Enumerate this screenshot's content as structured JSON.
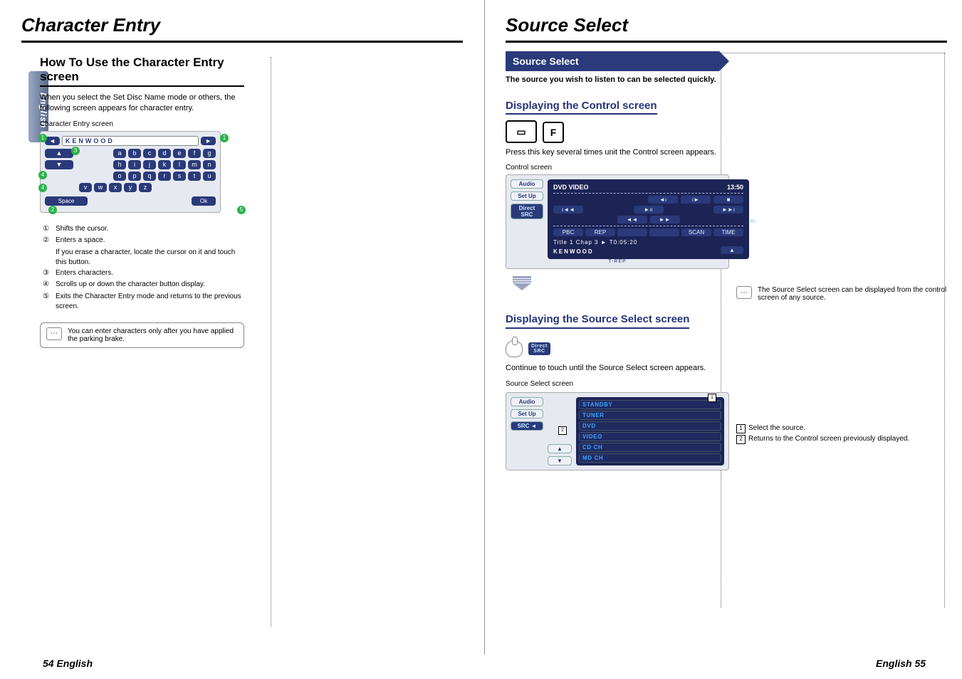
{
  "lang_tab": "English",
  "left": {
    "title": "Character Entry",
    "section_head": "How To Use the Character Entry screen",
    "intro": "When you select the Set Disc Name mode or others, the following screen appears for character entry.",
    "screen_caption": "Character Entry screen",
    "ce": {
      "text_value": "KENWOOD",
      "rows": [
        [
          "a",
          "b",
          "c",
          "d",
          "e",
          "f",
          "g"
        ],
        [
          "h",
          "i",
          "j",
          "k",
          "l",
          "m",
          "n"
        ],
        [
          "o",
          "p",
          "q",
          "r",
          "s",
          "t",
          "u"
        ],
        [
          "v",
          "w",
          "x",
          "y",
          "z"
        ]
      ],
      "space_label": "Space",
      "ok_label": "Ok",
      "badges": {
        "1": "1",
        "2": "2",
        "3": "3",
        "4": "4",
        "5": "5"
      }
    },
    "list": {
      "1": "Shifts the cursor.",
      "2": "Enters a space.",
      "2sub": "If you erase a character, locate the cursor on it and touch this button.",
      "3": "Enters characters.",
      "4": "Scrolls up or down the character button display.",
      "5": "Exits the Character Entry mode and returns to the previous screen."
    },
    "note": "You can enter characters only after you have applied the parking brake."
  },
  "right": {
    "title": "Source Select",
    "bar": "Source Select",
    "intro": "The source you wish to listen to can be selected quickly.",
    "sub1": "Displaying the Control screen",
    "key_small": "F",
    "press_text": "Press this key several times unit the Control screen appears.",
    "ctrl_caption": "Control screen",
    "ctrl": {
      "header_left": "DVD VIDEO",
      "header_right": "13:50",
      "side": [
        "Audio",
        "Set Up",
        "Direct SRC"
      ],
      "chips_row1": [
        "◄ı",
        "ı►",
        "■"
      ],
      "chips_row2": [
        "ı◄◄",
        "►ıı",
        "►►ı"
      ],
      "chips_row3": [
        "◄◄",
        "►►"
      ],
      "chips_row4": [
        "PBC",
        "REP",
        "",
        "",
        "SCAN",
        "TIME"
      ],
      "status1": "Title 1   Chap   3   ►   T0:05:20",
      "status2": "KENWOOD",
      "under": "T-REP",
      "in_badge": "IN"
    },
    "right_note": "The Source Select screen can be displayed from the control screen of any source.",
    "sub2": "Displaying the Source Select screen",
    "direct_chip_top": "Direct",
    "direct_chip_bot": "SRC",
    "continue_text": "Continue to touch until the Source Select screen appears.",
    "ss_caption": "Source Select screen",
    "ss": {
      "side": [
        "Audio",
        "Set Up",
        "SRC ◄"
      ],
      "nav_up": "▲",
      "nav_down": "▼",
      "items": [
        "STANDBY",
        "TUNER",
        "DVD",
        "VIDEO",
        "CD CH",
        "MD CH"
      ],
      "badge1": "1",
      "badge2": "2"
    },
    "right_col_list": {
      "1": "Select the source.",
      "2": "Returns to the Control screen previously displayed."
    }
  },
  "footer": {
    "left": "54 English",
    "right": "English 55"
  }
}
